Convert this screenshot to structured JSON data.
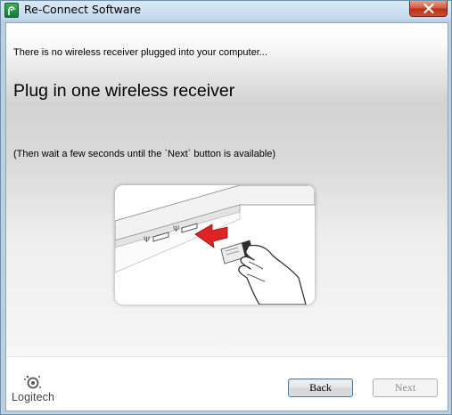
{
  "window": {
    "title": "Re-Connect Software",
    "close_icon": "close-icon",
    "app_icon": "logitech-app-icon"
  },
  "main": {
    "intro": "There is no wireless receiver plugged into your computer...",
    "heading": "Plug in one wireless receiver",
    "hint": "(Then wait a few seconds until the `Next` button is available)",
    "illustration": "plug-in-receiver-illustration"
  },
  "footer": {
    "logo_text": "Logitech",
    "back_label": "Back",
    "next_label": "Next"
  },
  "colors": {
    "arrow": "#e02424",
    "close_button": "#c9502f",
    "back_border": "#3c7fb1",
    "next_disabled_text": "#8f8f8f"
  }
}
